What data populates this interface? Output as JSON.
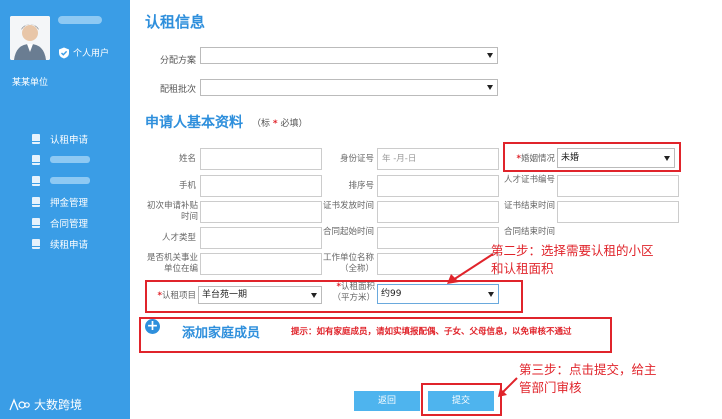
{
  "sidebar": {
    "user_type": "个人用户",
    "unit": "某某单位",
    "menu": [
      "认租申请",
      "",
      "",
      "押金管理",
      "合同管理",
      "续租申请"
    ],
    "logo_text": "大数跨境"
  },
  "section1": {
    "title": "认租信息",
    "plan_label": "分配方案",
    "batch_label": "配租批次"
  },
  "section2": {
    "title": "申请人基本资料",
    "note_prefix": "（标",
    "note_star": "*",
    "note_suffix": "必填）"
  },
  "form": {
    "name_label": "姓名",
    "id_label": "身份证号",
    "id_placeholder": "年 -月-日",
    "marital_label": "婚姻情况",
    "marital_value": "未婚",
    "phone_label": "手机",
    "order_label": "排序号",
    "talent_cert_label": "人才证书编号",
    "first_apply_label": "初次申请补贴时间",
    "cert_issue_label": "证书发放时间",
    "cert_end_label": "证书结束时间",
    "talent_type_label": "人才类型",
    "contract_start_label": "合同起始时间",
    "contract_end_label": "合同结束时间",
    "has_relation_label": "是否机关事业单位在编",
    "employer_label": "工作单位名称（全称）",
    "project_label": "认租项目",
    "project_value": "羊台苑一期",
    "area_label": "认租面积（平方米）",
    "area_value": "约99"
  },
  "family": {
    "add_label": "添加家庭成员",
    "tip": "提示：如有家庭成员，请如实填报配偶、子女、父母信息，以免审核不通过"
  },
  "buttons": {
    "back": "返回",
    "submit": "提交"
  },
  "annotations": {
    "step2": "第二步：选择需要认租的小区\n和认租面积",
    "step3": "第三步：点击提交，给主\n管部门审核"
  },
  "colors": {
    "sidebar": "#3a9de6",
    "accent": "#2e8fdc",
    "highlight": "#e0242b",
    "button": "#4eb4ee"
  }
}
